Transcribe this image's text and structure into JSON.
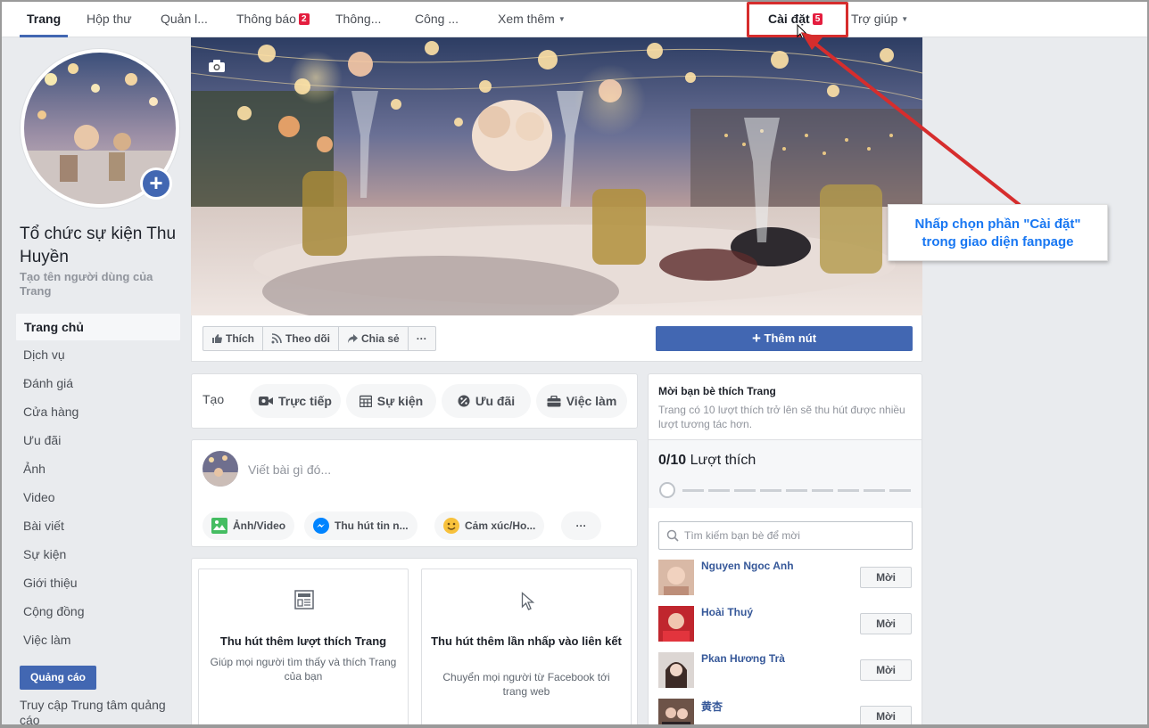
{
  "topnav": {
    "items": [
      {
        "label": "Trang"
      },
      {
        "label": "Hộp thư"
      },
      {
        "label": "Quản l..."
      },
      {
        "label": "Thông báo",
        "badge": "2"
      },
      {
        "label": "Thông..."
      },
      {
        "label": "Công ..."
      },
      {
        "label": "Xem thêm"
      },
      {
        "label": "Cài đặt",
        "badge": "5"
      },
      {
        "label": "Trợ giúp"
      }
    ]
  },
  "page": {
    "name": "Tổ chức sự kiện Thu Huyền",
    "username_link": "Tạo tên người dùng của Trang"
  },
  "sidebar": {
    "items": [
      {
        "label": "Trang chủ"
      },
      {
        "label": "Dịch vụ"
      },
      {
        "label": "Đánh giá"
      },
      {
        "label": "Cửa hàng"
      },
      {
        "label": "Ưu đãi"
      },
      {
        "label": "Ảnh"
      },
      {
        "label": "Video"
      },
      {
        "label": "Bài viết"
      },
      {
        "label": "Sự kiện"
      },
      {
        "label": "Giới thiệu"
      },
      {
        "label": "Cộng đồng"
      },
      {
        "label": "Việc làm"
      }
    ],
    "ads_button": "Quảng cáo",
    "ads_center": "Truy cập Trung tâm quảng cáo"
  },
  "actions": {
    "like": "Thích",
    "follow": "Theo dõi",
    "share": "Chia sẻ",
    "more": "···",
    "add_button": "Thêm nút"
  },
  "create": {
    "label": "Tạo",
    "items": [
      {
        "label": "Trực tiếp",
        "icon": "video-camera-icon"
      },
      {
        "label": "Sự kiện",
        "icon": "calendar-icon"
      },
      {
        "label": "Ưu đãi",
        "icon": "percent-icon"
      },
      {
        "label": "Việc làm",
        "icon": "briefcase-icon"
      }
    ]
  },
  "composer": {
    "placeholder": "Viết bài gì đó...",
    "options": [
      {
        "label": "Ảnh/Video",
        "icon": "photo-icon"
      },
      {
        "label": "Thu hút tin n...",
        "icon": "messenger-icon"
      },
      {
        "label": "Cảm xúc/Ho...",
        "icon": "smiley-icon"
      }
    ],
    "more": "···"
  },
  "promos": [
    {
      "title": "Thu hút thêm lượt thích Trang",
      "desc": "Giúp mọi người tìm thấy và thích Trang của bạn"
    },
    {
      "title": "Thu hút thêm lần nhấp vào liên kết",
      "desc": "Chuyển mọi người từ Facebook tới trang web"
    }
  ],
  "invite": {
    "title": "Mời bạn bè thích Trang",
    "subtitle": "Trang có 10 lượt thích trở lên sẽ thu hút được nhiều lượt tương tác hơn.",
    "likes_current": "0/10",
    "likes_label": "Lượt thích",
    "likes_progress": 0,
    "search_placeholder": "Tìm kiếm bạn bè để mời",
    "invite_label": "Mời",
    "friends": [
      {
        "name": "Nguyen Ngoc Anh"
      },
      {
        "name": "Hoài Thuý"
      },
      {
        "name": "Pkan Hương Trà"
      },
      {
        "name": "黄杏"
      }
    ]
  },
  "annotation": {
    "line1": "Nhấp chọn phần \"Cài đặt\"",
    "line2": "trong giao diện fanpage",
    "color": "#1877f2",
    "arrow_color": "#d62d2d"
  },
  "colors": {
    "brand": "#4267b2",
    "badge": "#e41e3f",
    "link": "#365899"
  }
}
